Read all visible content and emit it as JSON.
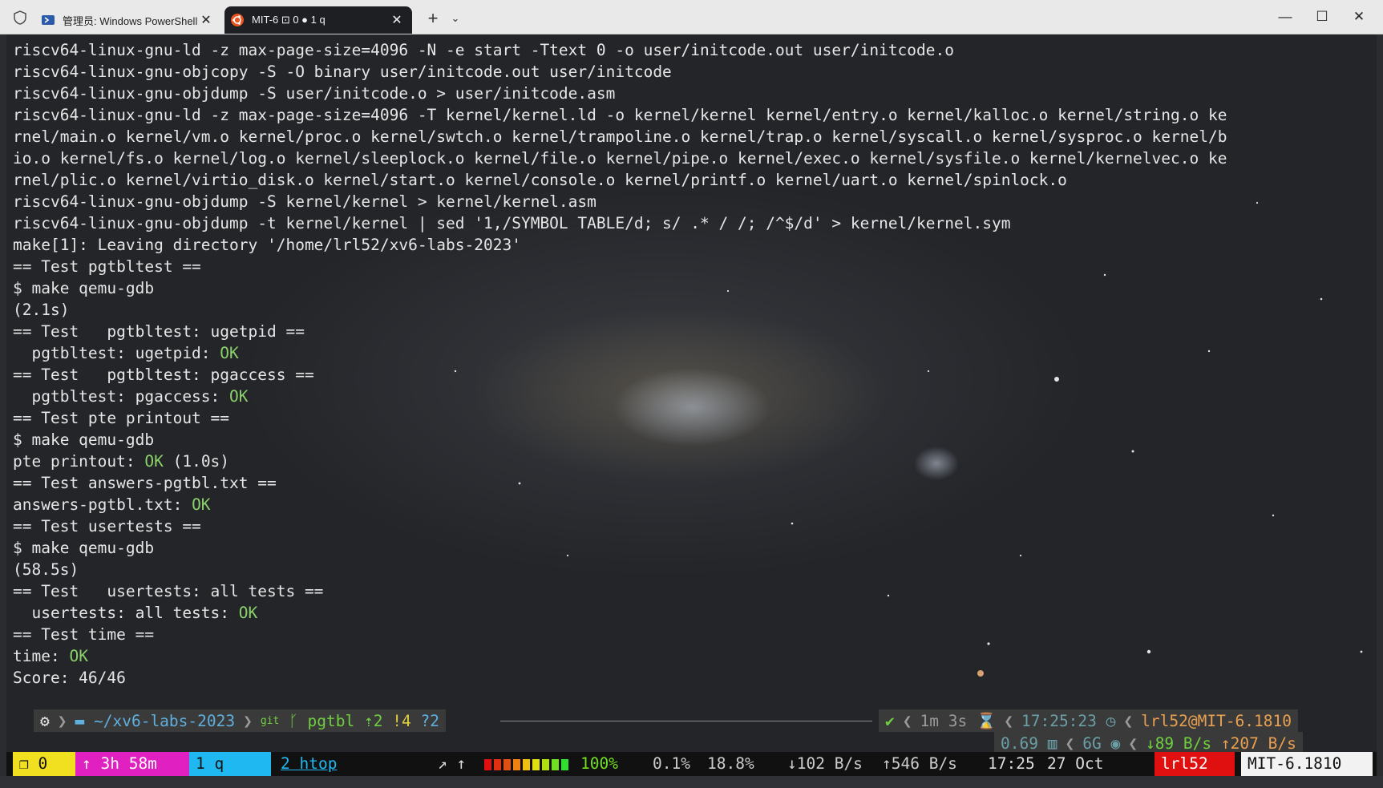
{
  "tabs": [
    {
      "label": "管理员: Windows PowerShell",
      "close": "✕",
      "icon": "powershell-icon"
    },
    {
      "label": "MIT-6 ⊡ 0 ● 1 q",
      "close": "✕",
      "icon": "ubuntu-icon"
    }
  ],
  "tabbar": {
    "new_tab": "+",
    "menu": "⌄",
    "minimize": "—",
    "maximize": "☐",
    "close": "✕"
  },
  "output_lines": [
    {
      "text": "riscv64-linux-gnu-ld -z max-page-size=4096 -N -e start -Ttext 0 -o user/initcode.out user/initcode.o",
      "ok": "",
      "after": ""
    },
    {
      "text": "riscv64-linux-gnu-objcopy -S -O binary user/initcode.out user/initcode",
      "ok": "",
      "after": ""
    },
    {
      "text": "riscv64-linux-gnu-objdump -S user/initcode.o > user/initcode.asm",
      "ok": "",
      "after": ""
    },
    {
      "text": "riscv64-linux-gnu-ld -z max-page-size=4096 -T kernel/kernel.ld -o kernel/kernel kernel/entry.o kernel/kalloc.o kernel/string.o ke",
      "ok": "",
      "after": ""
    },
    {
      "text": "rnel/main.o kernel/vm.o kernel/proc.o kernel/swtch.o kernel/trampoline.o kernel/trap.o kernel/syscall.o kernel/sysproc.o kernel/b",
      "ok": "",
      "after": ""
    },
    {
      "text": "io.o kernel/fs.o kernel/log.o kernel/sleeplock.o kernel/file.o kernel/pipe.o kernel/exec.o kernel/sysfile.o kernel/kernelvec.o ke",
      "ok": "",
      "after": ""
    },
    {
      "text": "rnel/plic.o kernel/virtio_disk.o kernel/start.o kernel/console.o kernel/printf.o kernel/uart.o kernel/spinlock.o",
      "ok": "",
      "after": ""
    },
    {
      "text": "riscv64-linux-gnu-objdump -S kernel/kernel > kernel/kernel.asm",
      "ok": "",
      "after": ""
    },
    {
      "text": "riscv64-linux-gnu-objdump -t kernel/kernel | sed '1,/SYMBOL TABLE/d; s/ .* / /; /^$/d' > kernel/kernel.sym",
      "ok": "",
      "after": ""
    },
    {
      "text": "make[1]: Leaving directory '/home/lrl52/xv6-labs-2023'",
      "ok": "",
      "after": ""
    },
    {
      "text": "== Test pgtbltest ==",
      "ok": "",
      "after": ""
    },
    {
      "text": "$ make qemu-gdb",
      "ok": "",
      "after": ""
    },
    {
      "text": "(2.1s)",
      "ok": "",
      "after": ""
    },
    {
      "text": "== Test   pgtbltest: ugetpid ==",
      "ok": "",
      "after": ""
    },
    {
      "text": "  pgtbltest: ugetpid: ",
      "ok": "OK",
      "after": ""
    },
    {
      "text": "== Test   pgtbltest: pgaccess ==",
      "ok": "",
      "after": ""
    },
    {
      "text": "  pgtbltest: pgaccess: ",
      "ok": "OK",
      "after": ""
    },
    {
      "text": "== Test pte printout ==",
      "ok": "",
      "after": ""
    },
    {
      "text": "$ make qemu-gdb",
      "ok": "",
      "after": ""
    },
    {
      "text": "pte printout: ",
      "ok": "OK",
      "after": " (1.0s)"
    },
    {
      "text": "== Test answers-pgtbl.txt ==",
      "ok": "",
      "after": ""
    },
    {
      "text": "answers-pgtbl.txt: ",
      "ok": "OK",
      "after": ""
    },
    {
      "text": "== Test usertests ==",
      "ok": "",
      "after": ""
    },
    {
      "text": "$ make qemu-gdb",
      "ok": "",
      "after": ""
    },
    {
      "text": "(58.5s)",
      "ok": "",
      "after": ""
    },
    {
      "text": "== Test   usertests: all tests ==",
      "ok": "",
      "after": ""
    },
    {
      "text": "  usertests: all tests: ",
      "ok": "OK",
      "after": ""
    },
    {
      "text": "== Test time ==",
      "ok": "",
      "after": ""
    },
    {
      "text": "time: ",
      "ok": "OK",
      "after": ""
    },
    {
      "text": "Score: 46/46",
      "ok": "",
      "after": ""
    }
  ],
  "prompt": {
    "os_icon": "⚙",
    "folder_icon": "▬",
    "path": "~/xv6-labs-2023",
    "git_label": "git",
    "branch_icon": "ᚴ",
    "branch": "pgtbl",
    "ahead": "⇡2",
    "modified": "!4",
    "untracked": "?2",
    "status_check": "✔",
    "duration": "1m 3s",
    "hourglass": "⌛",
    "clock": "17:25:23",
    "clock_icon": "◷",
    "user_host": "lrl52@MIT-6.1810",
    "load": "0.69",
    "load_icon": "▥",
    "ram": "6G",
    "ram_icon": "◉",
    "net_down": "↓89 B/s",
    "net_up": "↑207 B/s"
  },
  "tmux": {
    "session_icon": "❐",
    "session_index": "0",
    "uptime": "↑ 3h 58m",
    "window_current": "1 q",
    "window_other": "2 htop",
    "arrows": "↗ ↑",
    "battery_percent": "100%",
    "cpu": "0.1%",
    "mem": "18.8%",
    "down": "↓102 B/s",
    "up": "↑546 B/s",
    "time": "17:25",
    "date": "27 Oct",
    "user": "lrl52",
    "host": "MIT-6.1810"
  },
  "colors": {
    "ok": "#8bd16a",
    "tmux_session": "#f0e020",
    "tmux_uptime": "#e020c0",
    "tmux_window": "#20b8f0",
    "tmux_user": "#e01010"
  }
}
